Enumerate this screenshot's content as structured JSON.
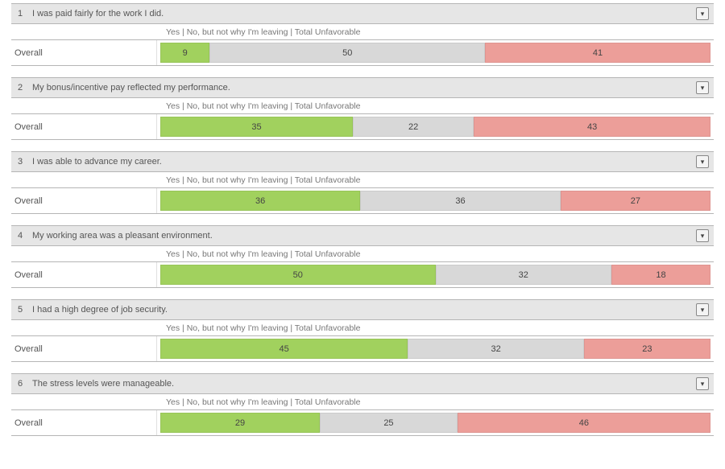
{
  "legend_text": "Yes | No, but not why I'm leaving | Total Unfavorable",
  "row_label": "Overall",
  "colors": {
    "yes": "#a1d15e",
    "neutral": "#d8d8d8",
    "unfavorable": "#ec9e99"
  },
  "questions": [
    {
      "num": "1",
      "text": "I was paid fairly for the work I did.",
      "values": {
        "yes": 9,
        "neutral": 50,
        "unfav": 41
      }
    },
    {
      "num": "2",
      "text": "My bonus/incentive pay reflected my performance.",
      "values": {
        "yes": 35,
        "neutral": 22,
        "unfav": 43
      }
    },
    {
      "num": "3",
      "text": "I was able to advance my career.",
      "values": {
        "yes": 36,
        "neutral": 36,
        "unfav": 27
      }
    },
    {
      "num": "4",
      "text": "My working area was a pleasant environment.",
      "values": {
        "yes": 50,
        "neutral": 32,
        "unfav": 18
      }
    },
    {
      "num": "5",
      "text": "I had a high degree of job security.",
      "values": {
        "yes": 45,
        "neutral": 32,
        "unfav": 23
      }
    },
    {
      "num": "6",
      "text": "The stress levels were manageable.",
      "values": {
        "yes": 29,
        "neutral": 25,
        "unfav": 46
      }
    }
  ],
  "chart_data": {
    "type": "bar",
    "orientation": "horizontal-stacked",
    "categories": [
      "Yes",
      "No, but not why I'm leaving",
      "Total Unfavorable"
    ],
    "row_label": "Overall",
    "xlim": [
      0,
      100
    ],
    "ylabel": "",
    "xlabel": "",
    "series": [
      {
        "name": "I was paid fairly for the work I did.",
        "values": [
          9,
          50,
          41
        ]
      },
      {
        "name": "My bonus/incentive pay reflected my performance.",
        "values": [
          35,
          22,
          43
        ]
      },
      {
        "name": "I was able to advance my career.",
        "values": [
          36,
          36,
          27
        ]
      },
      {
        "name": "My working area was a pleasant environment.",
        "values": [
          50,
          32,
          18
        ]
      },
      {
        "name": "I had a high degree of job security.",
        "values": [
          45,
          32,
          23
        ]
      },
      {
        "name": "The stress levels were manageable.",
        "values": [
          29,
          25,
          46
        ]
      }
    ]
  }
}
